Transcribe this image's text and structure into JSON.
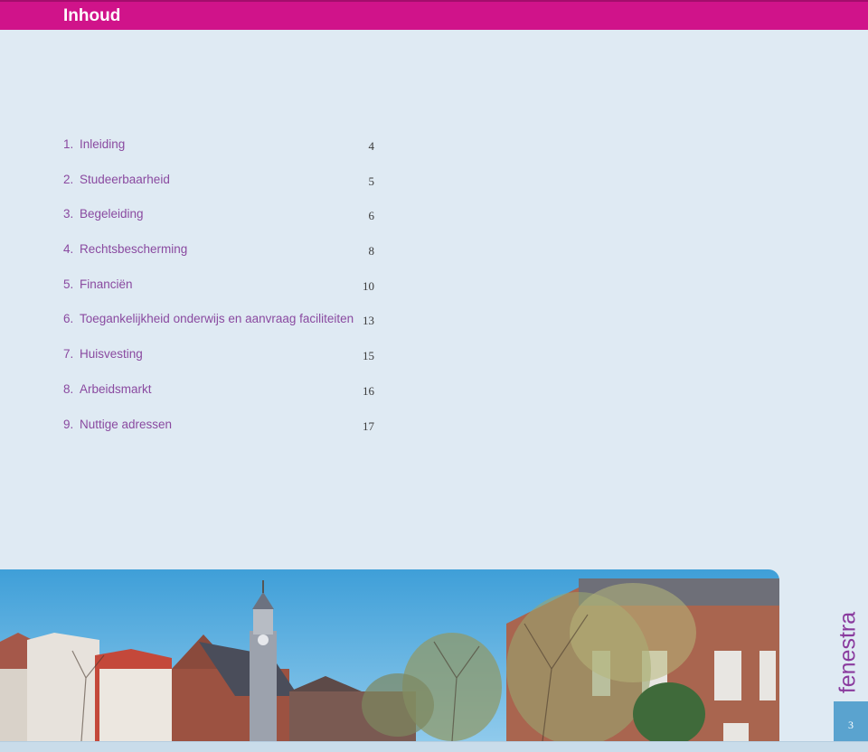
{
  "header": {
    "title": "Inhoud"
  },
  "toc": [
    {
      "num": "1.",
      "label": "Inleiding",
      "page": "4"
    },
    {
      "num": "2.",
      "label": "Studeerbaarheid",
      "page": "5"
    },
    {
      "num": "3.",
      "label": "Begeleiding",
      "page": "6"
    },
    {
      "num": "4.",
      "label": "Rechtsbescherming",
      "page": "8"
    },
    {
      "num": "5.",
      "label": "Financiën",
      "page": "10"
    },
    {
      "num": "6.",
      "label": "Toegankelijkheid onderwijs en aanvraag faciliteiten",
      "page": "13"
    },
    {
      "num": "7.",
      "label": "Huisvesting",
      "page": "15"
    },
    {
      "num": "8.",
      "label": "Arbeidsmarkt",
      "page": "16"
    },
    {
      "num": "9.",
      "label": "Nuttige adressen",
      "page": "17"
    }
  ],
  "brand": {
    "name": "fenestra"
  },
  "footer": {
    "page_number": "3"
  },
  "colors": {
    "header": "#d0138a",
    "toc_text": "#8a4aa0",
    "background": "#dfeaf3",
    "page_box": "#5aa3cf"
  }
}
